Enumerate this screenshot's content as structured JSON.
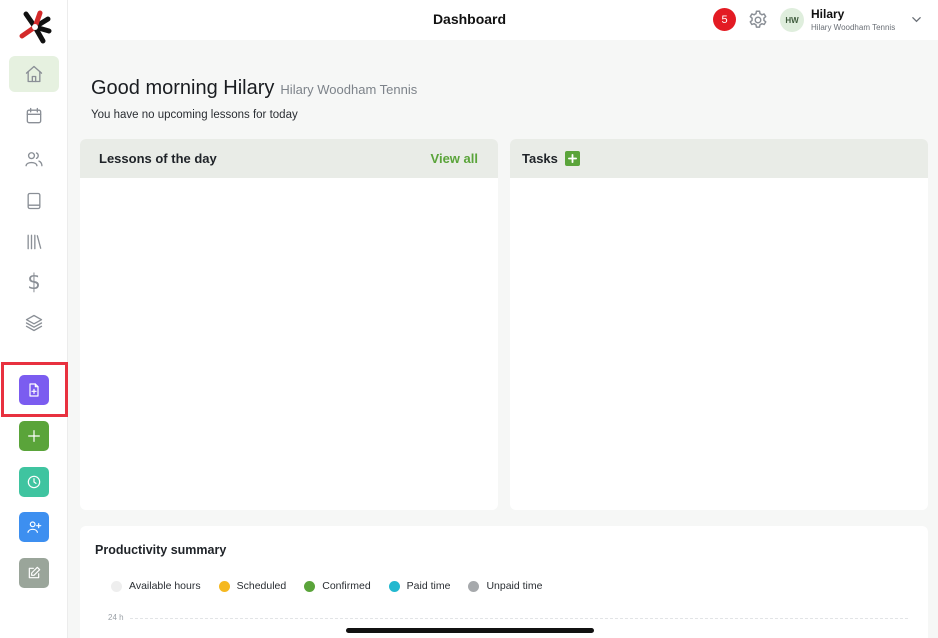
{
  "header": {
    "title": "Dashboard",
    "notifications": "5"
  },
  "user": {
    "initials": "HW",
    "name": "Hilary",
    "org": "Hilary Woodham Tennis"
  },
  "sidebar": {
    "nav": [
      {
        "icon": "home-icon"
      },
      {
        "icon": "calendar-icon"
      },
      {
        "icon": "users-icon"
      },
      {
        "icon": "book-icon"
      },
      {
        "icon": "library-icon"
      },
      {
        "icon": "dollar-icon",
        "glyph": "$"
      },
      {
        "icon": "layers-icon"
      }
    ],
    "actions": [
      {
        "icon": "document-add-icon",
        "color": "#7b5cf0"
      },
      {
        "icon": "plus-icon",
        "color": "#5aa43a"
      },
      {
        "icon": "clock-icon",
        "color": "#3fc4a0"
      },
      {
        "icon": "user-add-icon",
        "color": "#3d8ff0"
      },
      {
        "icon": "edit-icon",
        "color": "#9aa59a"
      }
    ]
  },
  "greeting": {
    "title": "Good morning Hilary",
    "org": "Hilary Woodham Tennis",
    "subtitle": "You have no upcoming lessons for today"
  },
  "lessons": {
    "title": "Lessons of the day",
    "view_all": "View all"
  },
  "tasks": {
    "title": "Tasks"
  },
  "productivity": {
    "title": "Productivity summary",
    "legend": [
      {
        "label": "Available hours",
        "color": "#eeeeee"
      },
      {
        "label": "Scheduled",
        "color": "#f5b820"
      },
      {
        "label": "Confirmed",
        "color": "#5aa43a"
      },
      {
        "label": "Paid time",
        "color": "#22b8cf"
      },
      {
        "label": "Unpaid time",
        "color": "#a6a9ac"
      }
    ],
    "axis_label": "24 h"
  }
}
